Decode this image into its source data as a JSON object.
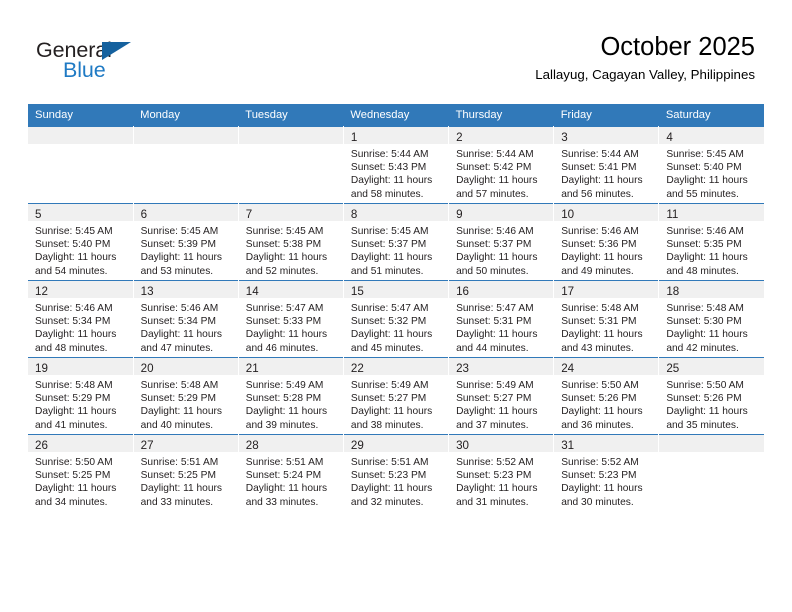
{
  "brand": {
    "name_part1": "General",
    "name_part2": "Blue",
    "triangle_color": "#15619e",
    "blue_color": "#1f7ac4"
  },
  "header": {
    "title": "October 2025",
    "subtitle": "Lallayug, Cagayan Valley, Philippines",
    "accent_color": "#3179b9"
  },
  "weekday_headers": [
    "Sunday",
    "Monday",
    "Tuesday",
    "Wednesday",
    "Thursday",
    "Friday",
    "Saturday"
  ],
  "weeks": [
    [
      {
        "day": "",
        "sunrise": "",
        "sunset": "",
        "daylight_line1": "",
        "daylight_line2": ""
      },
      {
        "day": "",
        "sunrise": "",
        "sunset": "",
        "daylight_line1": "",
        "daylight_line2": ""
      },
      {
        "day": "",
        "sunrise": "",
        "sunset": "",
        "daylight_line1": "",
        "daylight_line2": ""
      },
      {
        "day": "1",
        "sunrise": "Sunrise: 5:44 AM",
        "sunset": "Sunset: 5:43 PM",
        "daylight_line1": "Daylight: 11 hours",
        "daylight_line2": "and 58 minutes."
      },
      {
        "day": "2",
        "sunrise": "Sunrise: 5:44 AM",
        "sunset": "Sunset: 5:42 PM",
        "daylight_line1": "Daylight: 11 hours",
        "daylight_line2": "and 57 minutes."
      },
      {
        "day": "3",
        "sunrise": "Sunrise: 5:44 AM",
        "sunset": "Sunset: 5:41 PM",
        "daylight_line1": "Daylight: 11 hours",
        "daylight_line2": "and 56 minutes."
      },
      {
        "day": "4",
        "sunrise": "Sunrise: 5:45 AM",
        "sunset": "Sunset: 5:40 PM",
        "daylight_line1": "Daylight: 11 hours",
        "daylight_line2": "and 55 minutes."
      }
    ],
    [
      {
        "day": "5",
        "sunrise": "Sunrise: 5:45 AM",
        "sunset": "Sunset: 5:40 PM",
        "daylight_line1": "Daylight: 11 hours",
        "daylight_line2": "and 54 minutes."
      },
      {
        "day": "6",
        "sunrise": "Sunrise: 5:45 AM",
        "sunset": "Sunset: 5:39 PM",
        "daylight_line1": "Daylight: 11 hours",
        "daylight_line2": "and 53 minutes."
      },
      {
        "day": "7",
        "sunrise": "Sunrise: 5:45 AM",
        "sunset": "Sunset: 5:38 PM",
        "daylight_line1": "Daylight: 11 hours",
        "daylight_line2": "and 52 minutes."
      },
      {
        "day": "8",
        "sunrise": "Sunrise: 5:45 AM",
        "sunset": "Sunset: 5:37 PM",
        "daylight_line1": "Daylight: 11 hours",
        "daylight_line2": "and 51 minutes."
      },
      {
        "day": "9",
        "sunrise": "Sunrise: 5:46 AM",
        "sunset": "Sunset: 5:37 PM",
        "daylight_line1": "Daylight: 11 hours",
        "daylight_line2": "and 50 minutes."
      },
      {
        "day": "10",
        "sunrise": "Sunrise: 5:46 AM",
        "sunset": "Sunset: 5:36 PM",
        "daylight_line1": "Daylight: 11 hours",
        "daylight_line2": "and 49 minutes."
      },
      {
        "day": "11",
        "sunrise": "Sunrise: 5:46 AM",
        "sunset": "Sunset: 5:35 PM",
        "daylight_line1": "Daylight: 11 hours",
        "daylight_line2": "and 48 minutes."
      }
    ],
    [
      {
        "day": "12",
        "sunrise": "Sunrise: 5:46 AM",
        "sunset": "Sunset: 5:34 PM",
        "daylight_line1": "Daylight: 11 hours",
        "daylight_line2": "and 48 minutes."
      },
      {
        "day": "13",
        "sunrise": "Sunrise: 5:46 AM",
        "sunset": "Sunset: 5:34 PM",
        "daylight_line1": "Daylight: 11 hours",
        "daylight_line2": "and 47 minutes."
      },
      {
        "day": "14",
        "sunrise": "Sunrise: 5:47 AM",
        "sunset": "Sunset: 5:33 PM",
        "daylight_line1": "Daylight: 11 hours",
        "daylight_line2": "and 46 minutes."
      },
      {
        "day": "15",
        "sunrise": "Sunrise: 5:47 AM",
        "sunset": "Sunset: 5:32 PM",
        "daylight_line1": "Daylight: 11 hours",
        "daylight_line2": "and 45 minutes."
      },
      {
        "day": "16",
        "sunrise": "Sunrise: 5:47 AM",
        "sunset": "Sunset: 5:31 PM",
        "daylight_line1": "Daylight: 11 hours",
        "daylight_line2": "and 44 minutes."
      },
      {
        "day": "17",
        "sunrise": "Sunrise: 5:48 AM",
        "sunset": "Sunset: 5:31 PM",
        "daylight_line1": "Daylight: 11 hours",
        "daylight_line2": "and 43 minutes."
      },
      {
        "day": "18",
        "sunrise": "Sunrise: 5:48 AM",
        "sunset": "Sunset: 5:30 PM",
        "daylight_line1": "Daylight: 11 hours",
        "daylight_line2": "and 42 minutes."
      }
    ],
    [
      {
        "day": "19",
        "sunrise": "Sunrise: 5:48 AM",
        "sunset": "Sunset: 5:29 PM",
        "daylight_line1": "Daylight: 11 hours",
        "daylight_line2": "and 41 minutes."
      },
      {
        "day": "20",
        "sunrise": "Sunrise: 5:48 AM",
        "sunset": "Sunset: 5:29 PM",
        "daylight_line1": "Daylight: 11 hours",
        "daylight_line2": "and 40 minutes."
      },
      {
        "day": "21",
        "sunrise": "Sunrise: 5:49 AM",
        "sunset": "Sunset: 5:28 PM",
        "daylight_line1": "Daylight: 11 hours",
        "daylight_line2": "and 39 minutes."
      },
      {
        "day": "22",
        "sunrise": "Sunrise: 5:49 AM",
        "sunset": "Sunset: 5:27 PM",
        "daylight_line1": "Daylight: 11 hours",
        "daylight_line2": "and 38 minutes."
      },
      {
        "day": "23",
        "sunrise": "Sunrise: 5:49 AM",
        "sunset": "Sunset: 5:27 PM",
        "daylight_line1": "Daylight: 11 hours",
        "daylight_line2": "and 37 minutes."
      },
      {
        "day": "24",
        "sunrise": "Sunrise: 5:50 AM",
        "sunset": "Sunset: 5:26 PM",
        "daylight_line1": "Daylight: 11 hours",
        "daylight_line2": "and 36 minutes."
      },
      {
        "day": "25",
        "sunrise": "Sunrise: 5:50 AM",
        "sunset": "Sunset: 5:26 PM",
        "daylight_line1": "Daylight: 11 hours",
        "daylight_line2": "and 35 minutes."
      }
    ],
    [
      {
        "day": "26",
        "sunrise": "Sunrise: 5:50 AM",
        "sunset": "Sunset: 5:25 PM",
        "daylight_line1": "Daylight: 11 hours",
        "daylight_line2": "and 34 minutes."
      },
      {
        "day": "27",
        "sunrise": "Sunrise: 5:51 AM",
        "sunset": "Sunset: 5:25 PM",
        "daylight_line1": "Daylight: 11 hours",
        "daylight_line2": "and 33 minutes."
      },
      {
        "day": "28",
        "sunrise": "Sunrise: 5:51 AM",
        "sunset": "Sunset: 5:24 PM",
        "daylight_line1": "Daylight: 11 hours",
        "daylight_line2": "and 33 minutes."
      },
      {
        "day": "29",
        "sunrise": "Sunrise: 5:51 AM",
        "sunset": "Sunset: 5:23 PM",
        "daylight_line1": "Daylight: 11 hours",
        "daylight_line2": "and 32 minutes."
      },
      {
        "day": "30",
        "sunrise": "Sunrise: 5:52 AM",
        "sunset": "Sunset: 5:23 PM",
        "daylight_line1": "Daylight: 11 hours",
        "daylight_line2": "and 31 minutes."
      },
      {
        "day": "31",
        "sunrise": "Sunrise: 5:52 AM",
        "sunset": "Sunset: 5:23 PM",
        "daylight_line1": "Daylight: 11 hours",
        "daylight_line2": "and 30 minutes."
      },
      {
        "day": "",
        "sunrise": "",
        "sunset": "",
        "daylight_line1": "",
        "daylight_line2": ""
      }
    ]
  ]
}
